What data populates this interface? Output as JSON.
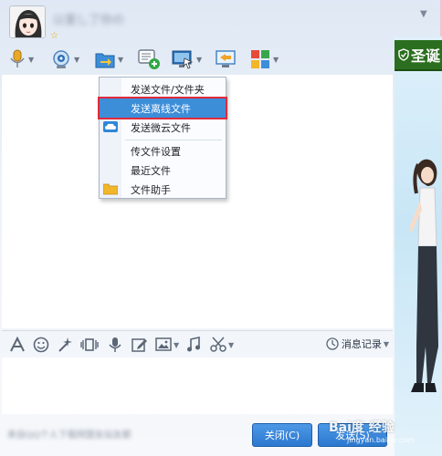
{
  "header": {
    "contact_name": "以爱し了你の",
    "star_badge": "☆"
  },
  "toolbar": {
    "items": [
      {
        "name": "voice-call",
        "icon": "microphone-icon"
      },
      {
        "name": "video-call",
        "icon": "webcam-icon"
      },
      {
        "name": "send-file",
        "icon": "file-transfer-icon"
      },
      {
        "name": "create-discussion",
        "icon": "add-chat-icon"
      },
      {
        "name": "remote-assist",
        "icon": "remote-desktop-icon"
      },
      {
        "name": "screen-share",
        "icon": "screen-share-icon"
      },
      {
        "name": "apps",
        "icon": "app-grid-icon"
      }
    ]
  },
  "file_menu": {
    "items": [
      {
        "label": "发送文件/文件夹",
        "icon": ""
      },
      {
        "label": "发送离线文件",
        "icon": "",
        "active": true
      },
      {
        "label": "发送微云文件",
        "icon": "cloud-icon"
      },
      {
        "label": "传文件设置",
        "icon": ""
      },
      {
        "label": "最近文件",
        "icon": ""
      },
      {
        "label": "文件助手",
        "icon": "folder-icon"
      }
    ]
  },
  "ad": {
    "banner_text": "圣诞"
  },
  "input_toolbar": {
    "history_label": "消息记录"
  },
  "footer": {
    "status_text": "来自QQ个人下载网盟友站友都",
    "close_label": "关闭(C)",
    "send_label": "发送(S)"
  },
  "watermark": {
    "brand": "Bai度 经验",
    "url": "jingyan.baidu.com"
  },
  "colors": {
    "accent": "#3d8ed9",
    "highlight_border": "#e02a3a",
    "button": "#2b78cf"
  }
}
